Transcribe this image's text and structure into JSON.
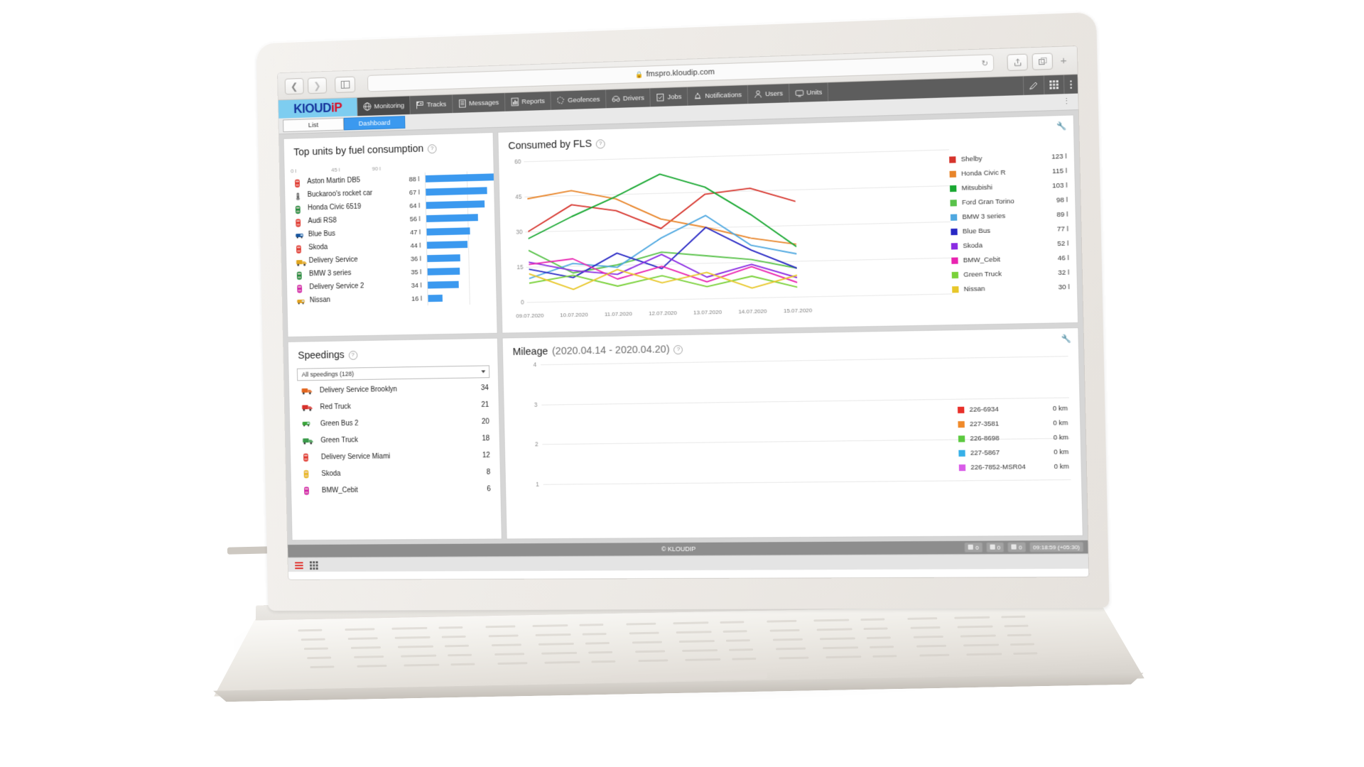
{
  "browser": {
    "back_icon": "chevron-left-icon",
    "forward_icon": "chevron-right-icon",
    "sidebar_icon": "sidebar-toggle-icon",
    "lock_icon": "lock-icon",
    "url": "fmspro.kloudip.com",
    "reload_icon": "reload-icon",
    "share_icon": "share-icon",
    "tabs_icon": "new-tab-icon",
    "plus_label": "+"
  },
  "app": {
    "logo": {
      "blue": "KlOUD",
      "red": "iP"
    },
    "nav": [
      {
        "label": "Monitoring",
        "icon": "globe-icon",
        "active": true
      },
      {
        "label": "Tracks",
        "icon": "flag-icon",
        "active": false
      },
      {
        "label": "Messages",
        "icon": "document-icon",
        "active": false
      },
      {
        "label": "Reports",
        "icon": "chart-icon",
        "active": false
      },
      {
        "label": "Geofences",
        "icon": "polygon-icon",
        "active": false
      },
      {
        "label": "Drivers",
        "icon": "driver-icon",
        "active": false
      },
      {
        "label": "Jobs",
        "icon": "job-icon",
        "active": false
      },
      {
        "label": "Notifications",
        "icon": "bell-icon",
        "active": false
      },
      {
        "label": "Users",
        "icon": "user-icon",
        "active": false
      },
      {
        "label": "Units",
        "icon": "units-icon",
        "active": false
      }
    ],
    "nav_right": [
      {
        "icon": "pen-icon"
      },
      {
        "icon": "grid-icon"
      },
      {
        "icon": "kebab-icon"
      }
    ],
    "tabs": [
      {
        "label": "List",
        "active": false
      },
      {
        "label": "Dashboard",
        "active": true
      }
    ],
    "tab_menu_icon": "kebab-icon"
  },
  "fuel_panel": {
    "title": "Top units by fuel consumption",
    "help_icon": "question-icon",
    "axis_ticks": [
      "0 l",
      "45 l",
      "90 l"
    ],
    "axis_max": 90,
    "chart_data": {
      "type": "bar",
      "title": "Top units by fuel consumption",
      "xlabel": "",
      "ylabel": "",
      "xlim": [
        0,
        90
      ],
      "unit": "l",
      "categories": [
        "Aston Martin DB5",
        "Buckaroo's rocket car",
        "Honda Civic 6519",
        "Audi RS8",
        "Blue Bus",
        "Skoda",
        "Delivery Service",
        "BMW 3 series",
        "Delivery Service 2",
        "Nissan"
      ],
      "values": [
        88,
        67,
        64,
        56,
        47,
        44,
        36,
        35,
        34,
        16
      ],
      "labels": [
        "88 l",
        "67 l",
        "64 l",
        "56 l",
        "47 l",
        "44 l",
        "36 l",
        "35 l",
        "34 l",
        "16 l"
      ],
      "icons": [
        "car-red-icon",
        "rocket-icon",
        "car-green-icon",
        "car-red-icon",
        "bus-blue-icon",
        "car-red-icon",
        "truck-yellow-icon",
        "car-green-icon",
        "car-magenta-icon",
        "van-orange-icon"
      ],
      "bar_color": "#3b99ef"
    }
  },
  "fls_panel": {
    "title": "Consumed by FLS",
    "help_icon": "question-icon",
    "settings_icon": "wrench-icon",
    "chart_data": {
      "type": "line",
      "title": "Consumed by FLS",
      "xlabel": "",
      "ylabel": "",
      "ylim": [
        0,
        60
      ],
      "yticks": [
        0,
        15,
        30,
        45,
        60
      ],
      "grid": true,
      "legend": "right",
      "x": [
        "09.07.2020",
        "10.07.2020",
        "11.07.2020",
        "12.07.2020",
        "13.07.2020",
        "14.07.2020",
        "15.07.2020"
      ],
      "series": [
        {
          "name": "Shelby",
          "total": "123 l",
          "color": "#d6342c",
          "values": [
            30,
            41,
            38,
            30,
            44,
            46,
            40
          ]
        },
        {
          "name": "Honda Civic R",
          "total": "115 l",
          "color": "#e8852a",
          "values": [
            44,
            47,
            43,
            34,
            30,
            25,
            22
          ]
        },
        {
          "name": "Mitsubishi",
          "total": "103 l",
          "color": "#19a832",
          "values": [
            27,
            36,
            44,
            53,
            47,
            35,
            21
          ]
        },
        {
          "name": "Ford Gran Torino",
          "total": "98 l",
          "color": "#59c24a",
          "values": [
            22,
            12,
            15,
            20,
            18,
            16,
            12
          ]
        },
        {
          "name": "BMW 3 series",
          "total": "89 l",
          "color": "#4fa8e0",
          "values": [
            10,
            16,
            14,
            26,
            35,
            22,
            18
          ]
        },
        {
          "name": "Blue Bus",
          "total": "77 l",
          "color": "#2727c4",
          "values": [
            14,
            10,
            20,
            13,
            30,
            20,
            12
          ]
        },
        {
          "name": "Skoda",
          "total": "52 l",
          "color": "#8a2be2",
          "values": [
            17,
            13,
            11,
            19,
            9,
            14,
            8
          ]
        },
        {
          "name": "BMW_Cebit",
          "total": "46 l",
          "color": "#e923b0",
          "values": [
            16,
            18,
            9,
            14,
            7,
            13,
            6
          ]
        },
        {
          "name": "Green Truck",
          "total": "32 l",
          "color": "#7ad13a",
          "values": [
            8,
            11,
            6,
            10,
            5,
            9,
            4
          ]
        },
        {
          "name": "Nissan",
          "total": "30 l",
          "color": "#e8c72a",
          "values": [
            12,
            5,
            13,
            7,
            11,
            4,
            9
          ]
        }
      ]
    }
  },
  "speedings_panel": {
    "title": "Speedings",
    "help_icon": "question-icon",
    "filter_value": "All speedings (128)",
    "dropdown_icon": "chevron-down-icon",
    "rows": [
      {
        "name": "Delivery Service Brooklyn",
        "count": "34",
        "icon": "truck-orange-icon"
      },
      {
        "name": "Red Truck",
        "count": "21",
        "icon": "truck-red-icon"
      },
      {
        "name": "Green Bus 2",
        "count": "20",
        "icon": "bus-green-icon"
      },
      {
        "name": "Green Truck",
        "count": "18",
        "icon": "truck-green-icon"
      },
      {
        "name": "Delivery Service Miami",
        "count": "12",
        "icon": "car-red-icon"
      },
      {
        "name": "Skoda",
        "count": "8",
        "icon": "car-yellow-icon"
      },
      {
        "name": "BMW_Cebit",
        "count": "6",
        "icon": "car-magenta-icon"
      }
    ]
  },
  "mileage_panel": {
    "title": "Mileage",
    "subtitle": "(2020.04.14 - 2020.04.20)",
    "help_icon": "question-icon",
    "settings_icon": "wrench-icon",
    "chart_data": {
      "type": "line",
      "title": "Mileage (2020.04.14 - 2020.04.20)",
      "ylim": [
        1,
        4
      ],
      "yticks": [
        1,
        2,
        3,
        4
      ],
      "grid": true,
      "legend": "right",
      "unit": "km",
      "series": [
        {
          "name": "226-6934",
          "total": "0 km",
          "color": "#e8302a",
          "values": [
            0,
            0,
            0,
            0,
            0,
            0,
            0
          ]
        },
        {
          "name": "227-3581",
          "total": "0 km",
          "color": "#f08a2a",
          "values": [
            0,
            0,
            0,
            0,
            0,
            0,
            0
          ]
        },
        {
          "name": "226-8698",
          "total": "0 km",
          "color": "#5cc93f",
          "values": [
            0,
            0,
            0,
            0,
            0,
            0,
            0
          ]
        },
        {
          "name": "227-5867",
          "total": "0 km",
          "color": "#37b0e8",
          "values": [
            0,
            0,
            0,
            0,
            0,
            0,
            0
          ]
        },
        {
          "name": "226-7852-MSR04",
          "total": "0 km",
          "color": "#d95ce8",
          "values": [
            0,
            0,
            0,
            0,
            0,
            0,
            0
          ]
        }
      ]
    }
  },
  "statusbar": {
    "copyright": "© KLOUDIP",
    "counters": [
      "0",
      "0",
      "0"
    ],
    "time": "09:18:59 (+05:30)",
    "icons": [
      "monitor-icon",
      "message-icon",
      "bell-icon",
      "event-icon",
      "calendar-icon"
    ]
  },
  "bottombar": {
    "icons": [
      "list-icon",
      "grid-icon"
    ]
  }
}
